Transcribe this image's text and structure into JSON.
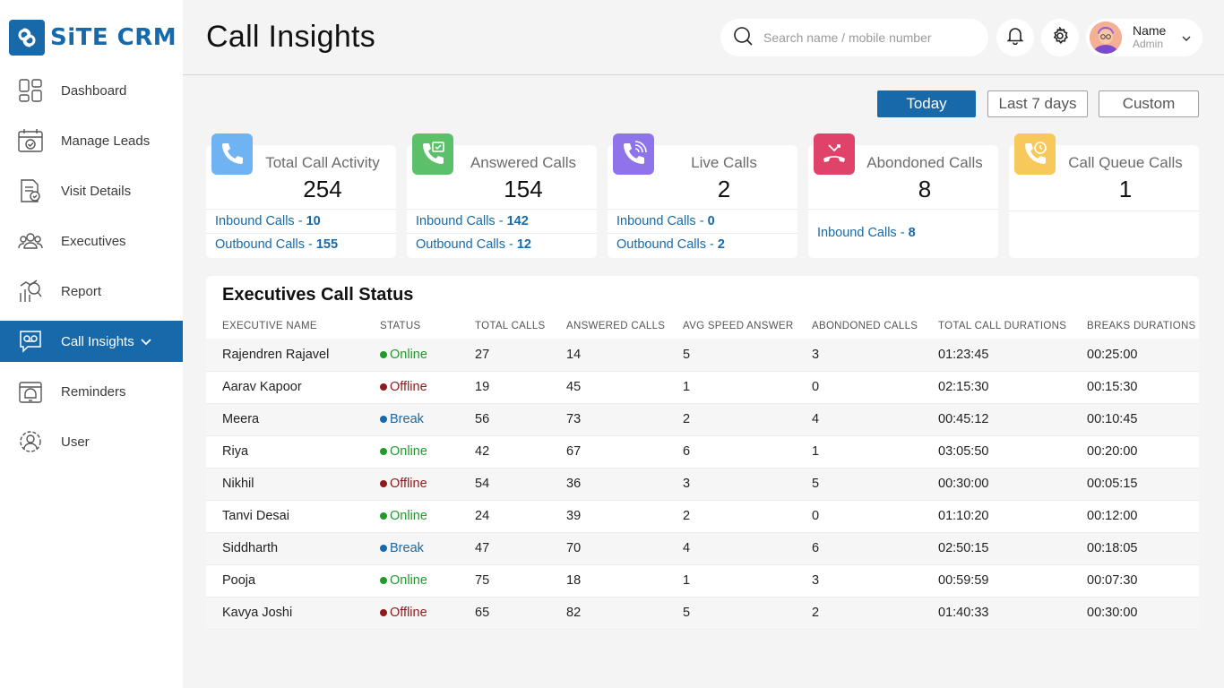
{
  "brand": {
    "name": "SiTE CRM",
    "accent": "#1769aa"
  },
  "sidebar": {
    "items": [
      {
        "label": "Dashboard",
        "icon": "dashboard-icon"
      },
      {
        "label": "Manage Leads",
        "icon": "calendar-check-icon"
      },
      {
        "label": "Visit Details",
        "icon": "document-icon"
      },
      {
        "label": "Executives",
        "icon": "users-icon"
      },
      {
        "label": "Report",
        "icon": "report-icon"
      },
      {
        "label": "Call Insights",
        "icon": "voicemail-chat-icon",
        "active": true
      },
      {
        "label": "Reminders",
        "icon": "alarm-icon"
      },
      {
        "label": "User",
        "icon": "user-settings-icon"
      }
    ]
  },
  "header": {
    "title": "Call Insights",
    "search_placeholder": "Search name / mobile number",
    "user": {
      "name": "Name",
      "role": "Admin"
    }
  },
  "filters": {
    "options": [
      "Today",
      "Last 7 days",
      "Custom"
    ],
    "selected": "Today"
  },
  "stats": [
    {
      "title": "Total Call Activity",
      "value": "254",
      "color": "#6fb3f2",
      "icon": "phone-icon",
      "rows": [
        {
          "label": "Inbound Calls - ",
          "value": "10"
        },
        {
          "label": "Outbound Calls - ",
          "value": "155"
        }
      ]
    },
    {
      "title": "Answered Calls",
      "value": "154",
      "color": "#5cc06a",
      "icon": "phone-check-icon",
      "rows": [
        {
          "label": "Inbound Calls - ",
          "value": "142"
        },
        {
          "label": "Outbound Calls - ",
          "value": "12"
        }
      ]
    },
    {
      "title": "Live Calls",
      "value": "2",
      "color": "#8f73ea",
      "icon": "phone-ringing-icon",
      "rows": [
        {
          "label": "Inbound Calls - ",
          "value": "0"
        },
        {
          "label": "Outbound Calls - ",
          "value": "2"
        }
      ]
    },
    {
      "title": "Abondoned Calls",
      "value": "8",
      "color": "#e0436a",
      "icon": "phone-hangup-icon",
      "rows": [
        {
          "label": "Inbound Calls - ",
          "value": "8"
        }
      ]
    },
    {
      "title": "Call Queue Calls",
      "value": "1",
      "color": "#f7c95a",
      "icon": "phone-clock-icon",
      "rows": []
    }
  ],
  "table": {
    "title": "Executives Call Status",
    "columns": [
      "EXECUTIVE NAME",
      "STATUS",
      "TOTAL CALLS",
      "ANSWERED CALLS",
      "AVG SPEED ANSWER",
      "ABONDONED CALLS",
      "TOTAL CALL DURATIONS",
      "BREAKS DURATIONS"
    ],
    "status_colors": {
      "Online": "#1f9a2b",
      "Offline": "#8e1b1b",
      "Break": "#1769aa"
    },
    "rows": [
      {
        "name": "Rajendren Rajavel",
        "status": "Online",
        "total": "27",
        "answered": "14",
        "avg": "5",
        "abandoned": "3",
        "duration": "01:23:45",
        "breaks": "00:25:00"
      },
      {
        "name": "Aarav Kapoor",
        "status": "Offline",
        "total": "19",
        "answered": "45",
        "avg": "1",
        "abandoned": "0",
        "duration": "02:15:30",
        "breaks": "00:15:30"
      },
      {
        "name": "Meera",
        "status": "Break",
        "total": "56",
        "answered": "73",
        "avg": "2",
        "abandoned": "4",
        "duration": "00:45:12",
        "breaks": "00:10:45"
      },
      {
        "name": "Riya",
        "status": "Online",
        "total": "42",
        "answered": "67",
        "avg": "6",
        "abandoned": "1",
        "duration": "03:05:50",
        "breaks": "00:20:00"
      },
      {
        "name": "Nikhil",
        "status": "Offline",
        "total": "54",
        "answered": "36",
        "avg": "3",
        "abandoned": "5",
        "duration": "00:30:00",
        "breaks": "00:05:15"
      },
      {
        "name": "Tanvi Desai",
        "status": "Online",
        "total": "24",
        "answered": "39",
        "avg": "2",
        "abandoned": "0",
        "duration": "01:10:20",
        "breaks": "00:12:00"
      },
      {
        "name": "Siddharth",
        "status": "Break",
        "total": "47",
        "answered": "70",
        "avg": "4",
        "abandoned": "6",
        "duration": "02:50:15",
        "breaks": "00:18:05"
      },
      {
        "name": "Pooja",
        "status": "Online",
        "total": "75",
        "answered": "18",
        "avg": "1",
        "abandoned": "3",
        "duration": "00:59:59",
        "breaks": "00:07:30"
      },
      {
        "name": "Kavya Joshi",
        "status": "Offline",
        "total": "65",
        "answered": "82",
        "avg": "5",
        "abandoned": "2",
        "duration": "01:40:33",
        "breaks": "00:30:00"
      }
    ]
  }
}
